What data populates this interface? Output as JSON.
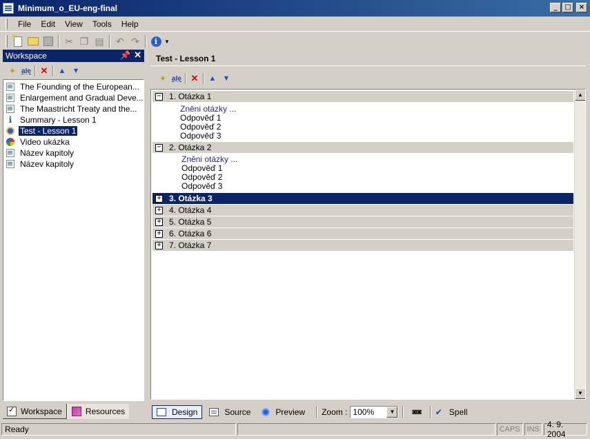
{
  "window": {
    "title": "Minimum_o_EU-eng-final",
    "buttons": [
      "_",
      "□",
      "×"
    ]
  },
  "menu": [
    "File",
    "Edit",
    "View",
    "Tools",
    "Help"
  ],
  "toolbar_icons": [
    "new-icon",
    "open-icon",
    "save-icon",
    "cut-icon",
    "copy-icon",
    "paste-icon",
    "undo-icon",
    "redo-icon",
    "info-icon"
  ],
  "workspace": {
    "title": "Workspace",
    "pin_glyph": "📌",
    "close_glyph": "✕",
    "items": [
      {
        "label": "The Founding of the European...",
        "icon": "document-icon"
      },
      {
        "label": "Enlargement and Gradual Deve...",
        "icon": "document-icon"
      },
      {
        "label": "The Maastricht Treaty and the...",
        "icon": "document-icon"
      },
      {
        "label": "Summary - Lesson 1",
        "icon": "info-icon"
      },
      {
        "label": "Test - Lesson 1",
        "icon": "test-icon",
        "selected": true
      },
      {
        "label": "Video ukázka",
        "icon": "video-icon"
      },
      {
        "label": "Název kapitoly",
        "icon": "document-icon"
      },
      {
        "label": "Název kapitoly",
        "icon": "document-icon"
      }
    ],
    "tabs": [
      {
        "label": "Workspace",
        "active": true
      },
      {
        "label": "Resources",
        "active": false
      }
    ]
  },
  "editor": {
    "title": "Test - Lesson 1",
    "questions": [
      {
        "label": "1. Otázka 1",
        "expanded": true,
        "text": "Zněni otázky ...",
        "answers": [
          "Odpověď 1",
          "Odpověď 2",
          "Odpověď 3"
        ]
      },
      {
        "label": "2. Otázka 2",
        "expanded": true,
        "text": "Zněni otázky ...",
        "answers": [
          "Odpověď 1",
          "Odpověď 2",
          "Odpověď 3"
        ]
      },
      {
        "label": "3. Otázka 3",
        "expanded": false,
        "selected": true
      },
      {
        "label": "4. Otázka 4",
        "expanded": false
      },
      {
        "label": "5. Otázka 5",
        "expanded": false
      },
      {
        "label": "6. Otázka 6",
        "expanded": false
      },
      {
        "label": "7. Otázka 7",
        "expanded": false
      }
    ],
    "toggle_collapse": "−",
    "toggle_expand": "+",
    "modes": [
      {
        "label": "Design",
        "active": true
      },
      {
        "label": "Source",
        "active": false
      },
      {
        "label": "Preview",
        "active": false
      }
    ],
    "zoom_label": "Zoom :",
    "zoom_value": "100%",
    "spell_label": "Spell"
  },
  "status": {
    "text": "Ready",
    "caps": "CAPS",
    "ins": "INS",
    "date": "4. 9. 2004"
  },
  "colors": {
    "title_bar": "#0a246a",
    "selection": "#0a246a",
    "question_text": "#1f1fa0",
    "chrome": "#d4d0c8"
  }
}
